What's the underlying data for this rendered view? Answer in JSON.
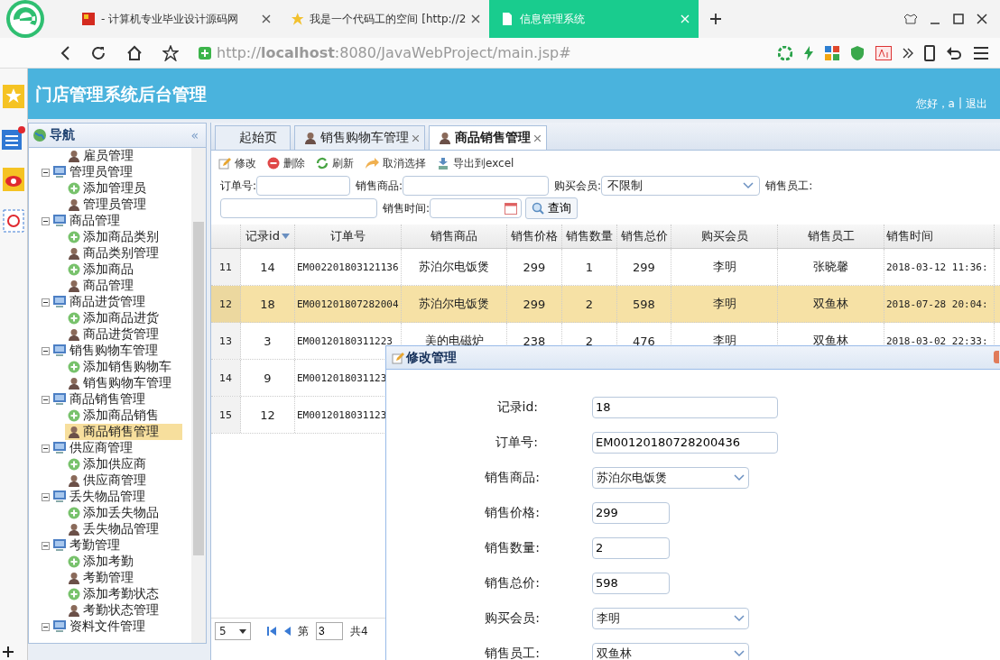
{
  "browser": {
    "tabs": [
      {
        "title": "- 计算机专业毕业设计源码网",
        "kind": "flag",
        "selected": false
      },
      {
        "title": "我是一个代码工的空间 [http://2",
        "kind": "star",
        "selected": false
      },
      {
        "title": "信息管理系统",
        "kind": "page",
        "selected": true
      }
    ],
    "address": "http://**localhost**:8080/JavaWebProject/main.jsp#"
  },
  "header": {
    "title": "门店管理系统后台管理",
    "greeting": "您好，a",
    "separator": "|",
    "logout": "退出"
  },
  "sidebar": {
    "title": "导航",
    "collapse": "«",
    "tree": [
      {
        "label": "雇员管理",
        "kind": "manage",
        "selected": false
      },
      {
        "label": "管理员管理",
        "expanded": true,
        "children": [
          {
            "label": "添加管理员",
            "kind": "add",
            "selected": false
          },
          {
            "label": "管理员管理",
            "kind": "manage",
            "selected": false
          }
        ]
      },
      {
        "label": "商品管理",
        "expanded": true,
        "children": [
          {
            "label": "添加商品类别",
            "kind": "add",
            "selected": false
          },
          {
            "label": "商品类别管理",
            "kind": "manage",
            "selected": false
          },
          {
            "label": "添加商品",
            "kind": "add",
            "selected": false
          },
          {
            "label": "商品管理",
            "kind": "manage",
            "selected": false
          }
        ]
      },
      {
        "label": "商品进货管理",
        "expanded": true,
        "children": [
          {
            "label": "添加商品进货",
            "kind": "add",
            "selected": false
          },
          {
            "label": "商品进货管理",
            "kind": "manage",
            "selected": false
          }
        ]
      },
      {
        "label": "销售购物车管理",
        "expanded": true,
        "children": [
          {
            "label": "添加销售购物车",
            "kind": "add",
            "selected": false
          },
          {
            "label": "销售购物车管理",
            "kind": "manage",
            "selected": false
          }
        ]
      },
      {
        "label": "商品销售管理",
        "expanded": true,
        "children": [
          {
            "label": "添加商品销售",
            "kind": "add",
            "selected": false
          },
          {
            "label": "商品销售管理",
            "kind": "manage",
            "selected": true
          }
        ]
      },
      {
        "label": "供应商管理",
        "expanded": true,
        "children": [
          {
            "label": "添加供应商",
            "kind": "add",
            "selected": false
          },
          {
            "label": "供应商管理",
            "kind": "manage",
            "selected": false
          }
        ]
      },
      {
        "label": "丢失物品管理",
        "expanded": true,
        "children": [
          {
            "label": "添加丢失物品",
            "kind": "add",
            "selected": false
          },
          {
            "label": "丢失物品管理",
            "kind": "manage",
            "selected": false
          }
        ]
      },
      {
        "label": "考勤管理",
        "expanded": true,
        "children": [
          {
            "label": "添加考勤",
            "kind": "add",
            "selected": false
          },
          {
            "label": "考勤管理",
            "kind": "manage",
            "selected": false
          },
          {
            "label": "添加考勤状态",
            "kind": "add",
            "selected": false
          },
          {
            "label": "考勤状态管理",
            "kind": "manage",
            "selected": false
          }
        ]
      },
      {
        "label": "资料文件管理",
        "expanded": true,
        "kind": "group"
      }
    ]
  },
  "tabs": [
    {
      "label": "起始页",
      "closable": false,
      "selected": false
    },
    {
      "label": "销售购物车管理",
      "closable": true,
      "selected": false
    },
    {
      "label": "商品销售管理",
      "closable": true,
      "selected": true
    }
  ],
  "toolbar": [
    {
      "label": "修改",
      "kind": "edit"
    },
    {
      "label": "删除",
      "kind": "delete"
    },
    {
      "label": "刷新",
      "kind": "refresh"
    },
    {
      "label": "取消选择",
      "kind": "undo"
    },
    {
      "label": "导出到excel",
      "kind": "export"
    }
  ],
  "search": {
    "fields": [
      {
        "label": "订单号:",
        "kind": "text"
      },
      {
        "label": "销售商品:",
        "kind": "wide"
      },
      {
        "label": "购买会员:",
        "kind": "select",
        "value": "不限制"
      },
      {
        "label": "销售员工:",
        "kind": "text"
      },
      {
        "label": "销售时间:",
        "kind": "date"
      }
    ],
    "button": "查询"
  },
  "table": {
    "columns": [
      {
        "label": "记录id",
        "sorted": true
      },
      {
        "label": "订单号"
      },
      {
        "label": "销售商品"
      },
      {
        "label": "销售价格"
      },
      {
        "label": "销售数量"
      },
      {
        "label": "销售总价"
      },
      {
        "label": "购买会员"
      },
      {
        "label": "销售员工"
      },
      {
        "label": "销售时间"
      }
    ],
    "rows": [
      {
        "selected": false,
        "number": "11",
        "cells": [
          "14",
          "EM002201803121136",
          "苏泊尔电饭煲",
          "299",
          "1",
          "299",
          "李明",
          "张晓馨",
          "2018-03-12 11:36:"
        ]
      },
      {
        "selected": true,
        "number": "12",
        "cells": [
          "18",
          "EM001201807282004",
          "苏泊尔电饭煲",
          "299",
          "2",
          "598",
          "李明",
          "双鱼林",
          "2018-07-28 20:04:"
        ]
      },
      {
        "selected": false,
        "number": "13",
        "cells": [
          "3",
          "EM00120180311223",
          "美的电磁炉",
          "238",
          "2",
          "476",
          "李明",
          "双鱼林",
          "2018-03-02 22:33:"
        ]
      },
      {
        "selected": false,
        "number": "14",
        "cells": [
          "9",
          "EM0012018031123"
        ]
      },
      {
        "selected": false,
        "number": "15",
        "cells": [
          "12",
          "EM0012018031123"
        ]
      }
    ]
  },
  "pager": {
    "page_size": "5",
    "before": "第",
    "page": "3",
    "total": "共4"
  },
  "dialog": {
    "title": "修改管理",
    "fields": [
      {
        "label": "记录id:",
        "kind": "text",
        "value": "18"
      },
      {
        "label": "订单号:",
        "kind": "text",
        "value": "EM00120180728200436"
      },
      {
        "label": "销售商品:",
        "kind": "select",
        "value": "苏泊尔电饭煲"
      },
      {
        "label": "销售价格:",
        "kind": "number",
        "value": "299"
      },
      {
        "label": "销售数量:",
        "kind": "number",
        "value": "2"
      },
      {
        "label": "销售总价:",
        "kind": "number",
        "value": "598"
      },
      {
        "label": "购买会员:",
        "kind": "select",
        "value": "李明"
      },
      {
        "label": "销售员工:",
        "kind": "select",
        "value": "双鱼林"
      }
    ]
  }
}
